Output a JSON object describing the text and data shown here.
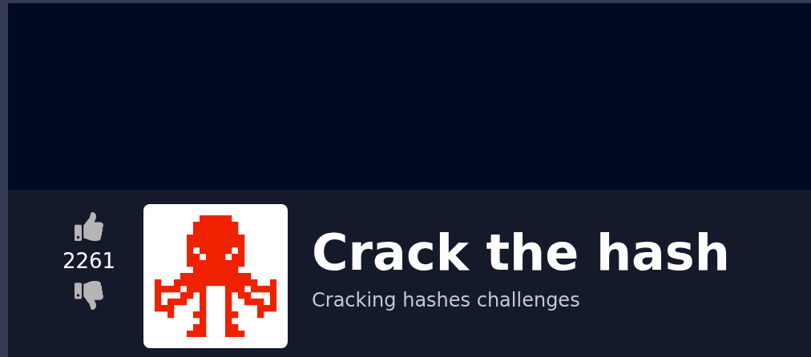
{
  "votes": {
    "count": "2261"
  },
  "room": {
    "title": "Crack the hash",
    "subtitle": "Cracking hashes challenges"
  }
}
